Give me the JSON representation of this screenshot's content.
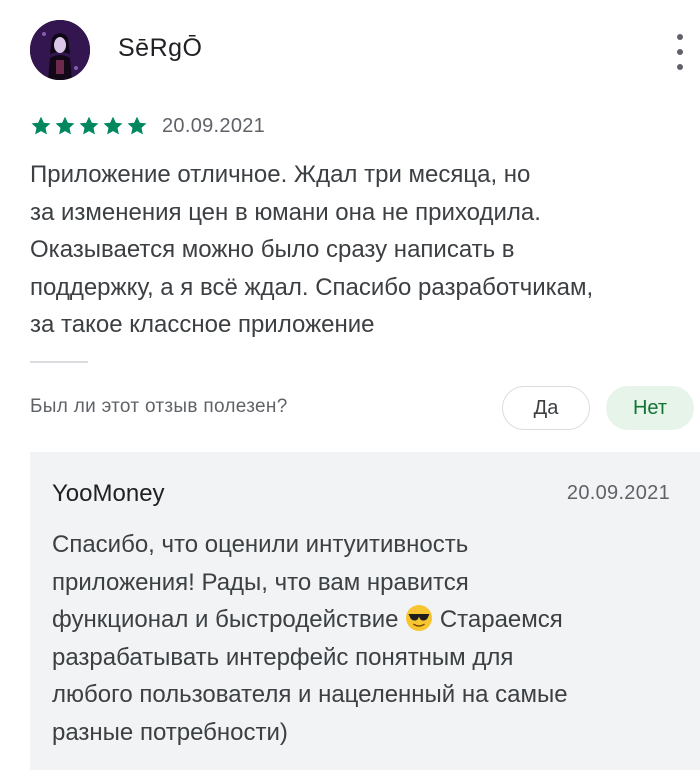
{
  "review": {
    "author": "SēRgŌ",
    "avatar_icon": "user-avatar",
    "rating": 5,
    "rating_max": 5,
    "star_color": "#01875f",
    "date": "20.09.2021",
    "text": "Приложение отличное. Ждал три месяца, но\nза изменения цен в юмани она не приходила.\nОказывается можно было сразу написать в\nподдержку, а я всё ждал. Спасибо разработчикам,\nза такое классное приложение",
    "more_icon": "more-vert-icon"
  },
  "helpful": {
    "question": "Был ли этот отзыв полезен?",
    "yes_label": "Да",
    "no_label": "Нет"
  },
  "developer_reply": {
    "author": "YooMoney",
    "date": "20.09.2021",
    "text_part1": "Спасибо, что оценили интуитивность\nприложения! Рады, что вам нравится\nфункционал и быстродействие ",
    "emoji_icon": "sunglasses-emoji-icon",
    "text_part2": " Стараемся\nразрабатывать интерфейс понятным для\nлюбого пользователя и нацеленный на самые\nразные потребности)"
  }
}
